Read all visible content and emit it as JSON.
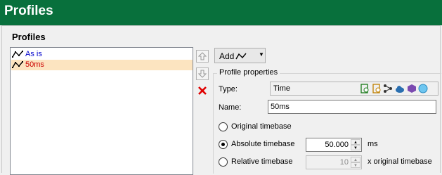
{
  "header": {
    "title": "Profiles"
  },
  "profiles": {
    "title": "Profiles",
    "items": [
      {
        "label": "As is",
        "color": "#0000cc",
        "selected": false
      },
      {
        "label": "50ms",
        "color": "#cc0000",
        "selected": true
      }
    ]
  },
  "toolbar": {
    "add_label": "Add",
    "add_icon": "profile-curve-icon"
  },
  "side_buttons": [
    "move-up-icon",
    "move-down-icon",
    "delete-icon"
  ],
  "properties": {
    "group_title": "Profile properties",
    "type_label": "Type:",
    "type_value": "Time",
    "type_icons": [
      "time-profile-icon",
      "frequency-profile-icon",
      "share-icon",
      "cloud-icon",
      "cube-icon",
      "globe-icon"
    ],
    "name_label": "Name:",
    "name_value": "50ms",
    "timebase_options": [
      {
        "label": "Original timebase",
        "checked": false
      },
      {
        "label": "Absolute timebase",
        "checked": true,
        "value": "50.000",
        "unit": "ms"
      },
      {
        "label": "Relative timebase",
        "checked": false,
        "value": "10",
        "unit": "x original timebase",
        "disabled": true
      }
    ]
  },
  "colors": {
    "header": "#08703c",
    "selection": "#fce4c0",
    "delete": "#e00000"
  }
}
